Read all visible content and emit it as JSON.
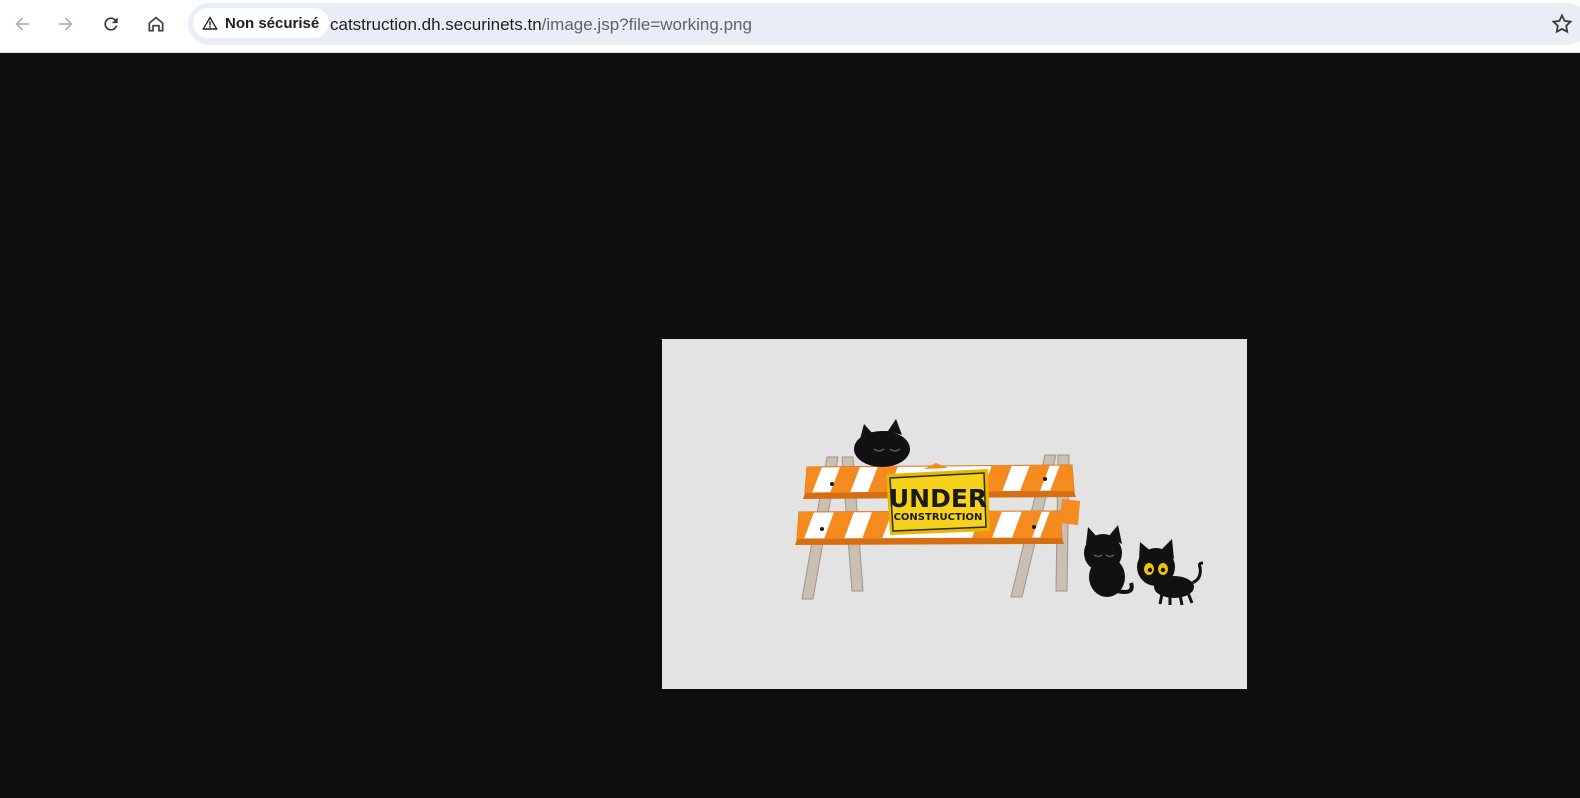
{
  "browser": {
    "back_icon": "arrow-left-icon",
    "forward_icon": "arrow-right-icon",
    "reload_icon": "reload-icon",
    "home_icon": "home-icon",
    "security": {
      "icon": "warning-triangle-icon",
      "label": "Non sécurisé"
    },
    "url": {
      "host": "catstruction.dh.securinets.tn",
      "path": "/image.jsp?file=working.png"
    },
    "bookmark_icon": "star-icon"
  },
  "viewer": {
    "background_color": "#0e0e0e",
    "image": {
      "sign_line1": "UNDER",
      "sign_line2": "CONSTRUCTION",
      "barrier_orange": "#f58a1f",
      "sign_yellow": "#f7d21a",
      "cat_count": 3
    }
  }
}
